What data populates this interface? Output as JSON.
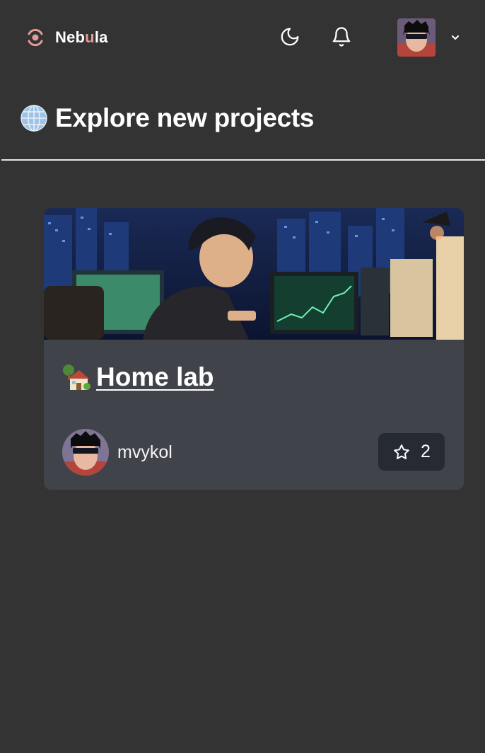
{
  "app": {
    "brand_prefix": "Neb",
    "brand_accent": "u",
    "brand_suffix": "la",
    "accent_color": "#e59a9a"
  },
  "header": {
    "theme_icon": "moon-icon",
    "notifications_icon": "bell-icon",
    "user_menu_icon": "chevron-down-icon"
  },
  "page": {
    "title_emoji": "globe-icon",
    "title": "Explore new projects"
  },
  "projects": [
    {
      "emoji": "house-icon",
      "title": "Home lab",
      "author": "mvykol",
      "stars": "2",
      "star_icon": "star-icon"
    }
  ]
}
